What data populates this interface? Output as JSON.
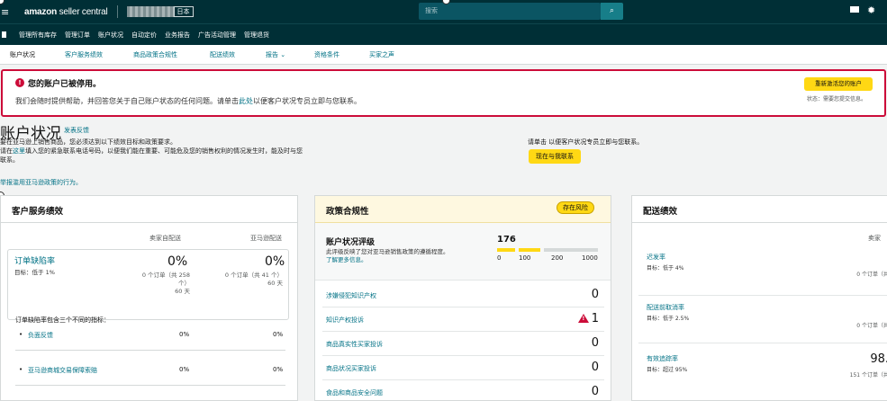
{
  "topbar": {
    "menu_icon": "menu-icon",
    "logo_main": "amazon",
    "logo_sub": " seller central",
    "marketplace": "日本",
    "search_placeholder": "搜索",
    "search_icon": "search-icon",
    "mail_icon": "mail-icon",
    "settings_icon": "gear-icon"
  },
  "navbar": {
    "items": [
      "管理所有库存",
      "管理订单",
      "账户状况",
      "自动定价",
      "业务报告",
      "广告活动管理",
      "管理退货"
    ]
  },
  "subnav": {
    "items": [
      "账户状况",
      "客户服务绩效",
      "商品政策合规性",
      "配送绩效",
      "报告 ⌄",
      "资格条件",
      "买家之声"
    ]
  },
  "alert": {
    "title": "您的账户已被停用。",
    "body_pre": "我们会随时提供帮助，并回答您关于自己账户状态的任何问题。请单击",
    "body_link": "此处",
    "body_post": "以便客户状况专员立即与您联系。",
    "button": "重新激活您的账户",
    "status": "状态：需要您提交信息。"
  },
  "header": {
    "title": "账户状况",
    "feedback": "发表反馈",
    "intro_line1": "要在亚马逊上销售商品，您必须达到以下绩效目标和政策要求。",
    "intro_line2_pre": "请在",
    "intro_line2_link": "这里",
    "intro_line2_post": "填入您的紧急联系电话号码，以便我们能在重要、可能危及您的销售权利的情况发生时，能及时与您联系。",
    "report_link": "举报滥用亚马逊政策的行为。",
    "contact_note": "请单击 以便客户状况专员立即与您联系。",
    "contact_button": "现在与我联系"
  },
  "customer_service": {
    "title": "客户服务绩效",
    "col_seller": "卖家自配送",
    "col_amazon": "亚马逊配送",
    "odr": {
      "label": "订单缺陷率",
      "target": "目标：低于 1%",
      "seller_pct": "0%",
      "seller_sub1": "0 个订单（共 258",
      "seller_sub2": "个）",
      "seller_days": "60 天",
      "amazon_pct": "0%",
      "amazon_sub": "0 个订单（共 41 个）",
      "amazon_days": "60 天"
    },
    "metrics_caption": "订单缺陷率包含三个不同的指标：",
    "metrics": [
      {
        "label": "负面反馈",
        "seller": "0%",
        "amazon": "0%"
      },
      {
        "label": "亚马逊商城交易保障索赔",
        "seller": "0%",
        "amazon": "0%"
      }
    ]
  },
  "policy": {
    "title": "政策合规性",
    "risk_badge": "存在风险",
    "ahr_title": "账户状况评级",
    "ahr_desc": "此评级反映了您对亚马逊销售政策的遵循程度。",
    "ahr_learn_more": "了解更多信息。",
    "ahr_score": "176",
    "ahr_score_value": 176,
    "ahr_ticks": [
      "0",
      "100",
      "200",
      "1000"
    ],
    "rows": [
      {
        "label": "涉嫌侵犯知识产权",
        "value": "0",
        "warning": false
      },
      {
        "label": "知识产权投诉",
        "value": "1",
        "warning": true
      },
      {
        "label": "商品真实性买家投诉",
        "value": "0",
        "warning": false
      },
      {
        "label": "商品状况买家投诉",
        "value": "0",
        "warning": false
      },
      {
        "label": "食品和商品安全问题",
        "value": "0",
        "warning": false
      }
    ]
  },
  "shipping": {
    "title": "配送绩效",
    "col_seller": "卖家",
    "rows": [
      {
        "label": "迟发率",
        "target": "目标：低于 4%",
        "sub": "0 个订单（共",
        "big": ""
      },
      {
        "label": "配送前取消率",
        "target": "目标：低于 2.5%",
        "sub": "0 个订单（共",
        "big": ""
      },
      {
        "label": "有效追踪率",
        "target": "目标：超过 95%",
        "sub": "151 个订单（共",
        "big": "98."
      }
    ]
  },
  "colors": {
    "header_bg": "#002f36",
    "alert_red": "#cc0c39",
    "button_yellow": "#ffd814",
    "link_teal": "#007185"
  }
}
